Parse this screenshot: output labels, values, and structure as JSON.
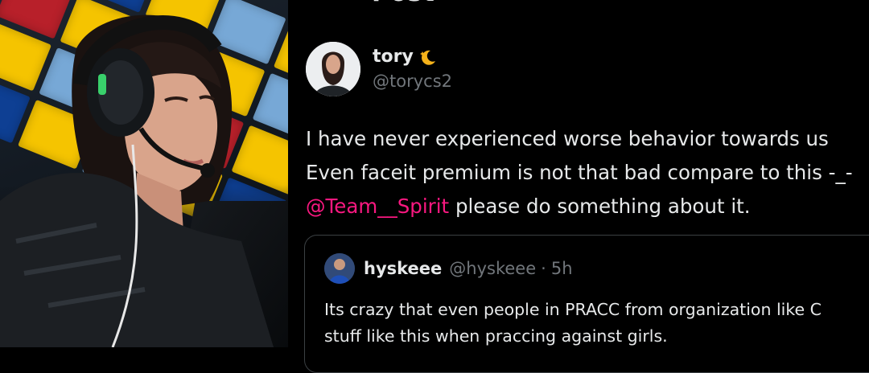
{
  "tweet": {
    "header_fragment": "Post",
    "display_name": "tory",
    "handle": "@torycs2",
    "lines": [
      "I have never experienced worse behavior towards us",
      "Even faceit premium is not that bad compare to this -_-"
    ],
    "mention": "@Team__Spirit",
    "mention_suffix": " please do something about it.",
    "name_emoji_icon": "crescent-moon-stars-icon"
  },
  "quote": {
    "display_name": "hyskeee",
    "handle": "@hyskeee",
    "separator": "·",
    "time": "5h",
    "lines": [
      "Its crazy that even people in PRACC from organization like C",
      "stuff like this when praccing against girls."
    ]
  },
  "colors": {
    "background": "#000000",
    "text_primary": "#e7e9ea",
    "text_secondary": "#71767b",
    "mention": "#f91880",
    "quote_border": "#3b4043"
  }
}
